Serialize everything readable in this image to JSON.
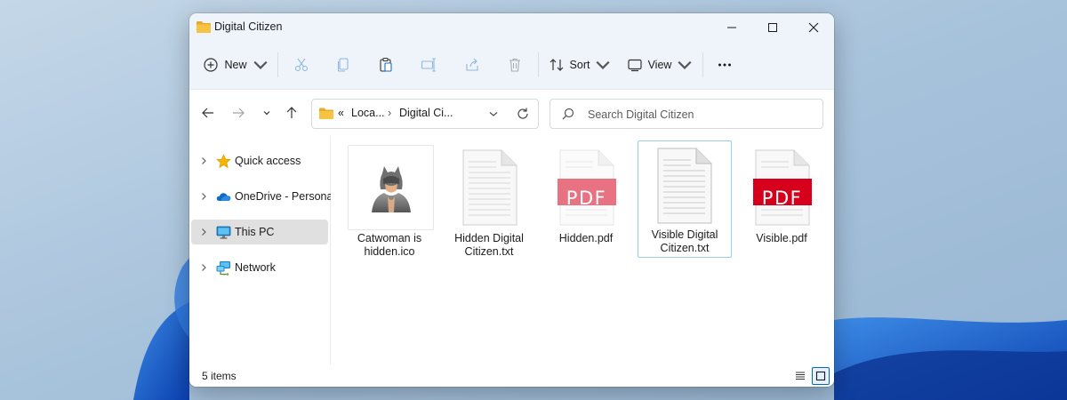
{
  "window": {
    "title": "Digital Citizen"
  },
  "toolbar": {
    "new_label": "New",
    "sort_label": "Sort",
    "view_label": "View"
  },
  "address": {
    "overflow": "«",
    "segments": [
      "Loca...",
      "Digital Ci..."
    ],
    "separator": "›"
  },
  "search": {
    "placeholder": "Search Digital Citizen"
  },
  "navpane": {
    "items": [
      {
        "label": "Quick access",
        "icon": "star-icon"
      },
      {
        "label": "OneDrive - Personal",
        "icon": "onedrive-cloud-icon"
      },
      {
        "label": "This PC",
        "icon": "pc-monitor-icon"
      },
      {
        "label": "Network",
        "icon": "network-icon"
      }
    ]
  },
  "files": [
    {
      "line1": "Catwoman is",
      "line2": "hidden.ico",
      "type": "ico"
    },
    {
      "line1": "Hidden Digital",
      "line2": "Citizen.txt",
      "type": "txt"
    },
    {
      "line1": "Hidden.pdf",
      "line2": "",
      "type": "pdf"
    },
    {
      "line1": "Visible Digital",
      "line2": "Citizen.txt",
      "type": "txt"
    },
    {
      "line1": "Visible.pdf",
      "line2": "",
      "type": "pdf"
    }
  ],
  "pdf_badge": "PDF",
  "status": {
    "items_count": "5 items"
  },
  "colors": {
    "accent": "#0067c0",
    "pdf_red": "#d6001c",
    "folder_yellow": "#f6c342",
    "selection_border": "#99d1ec"
  }
}
